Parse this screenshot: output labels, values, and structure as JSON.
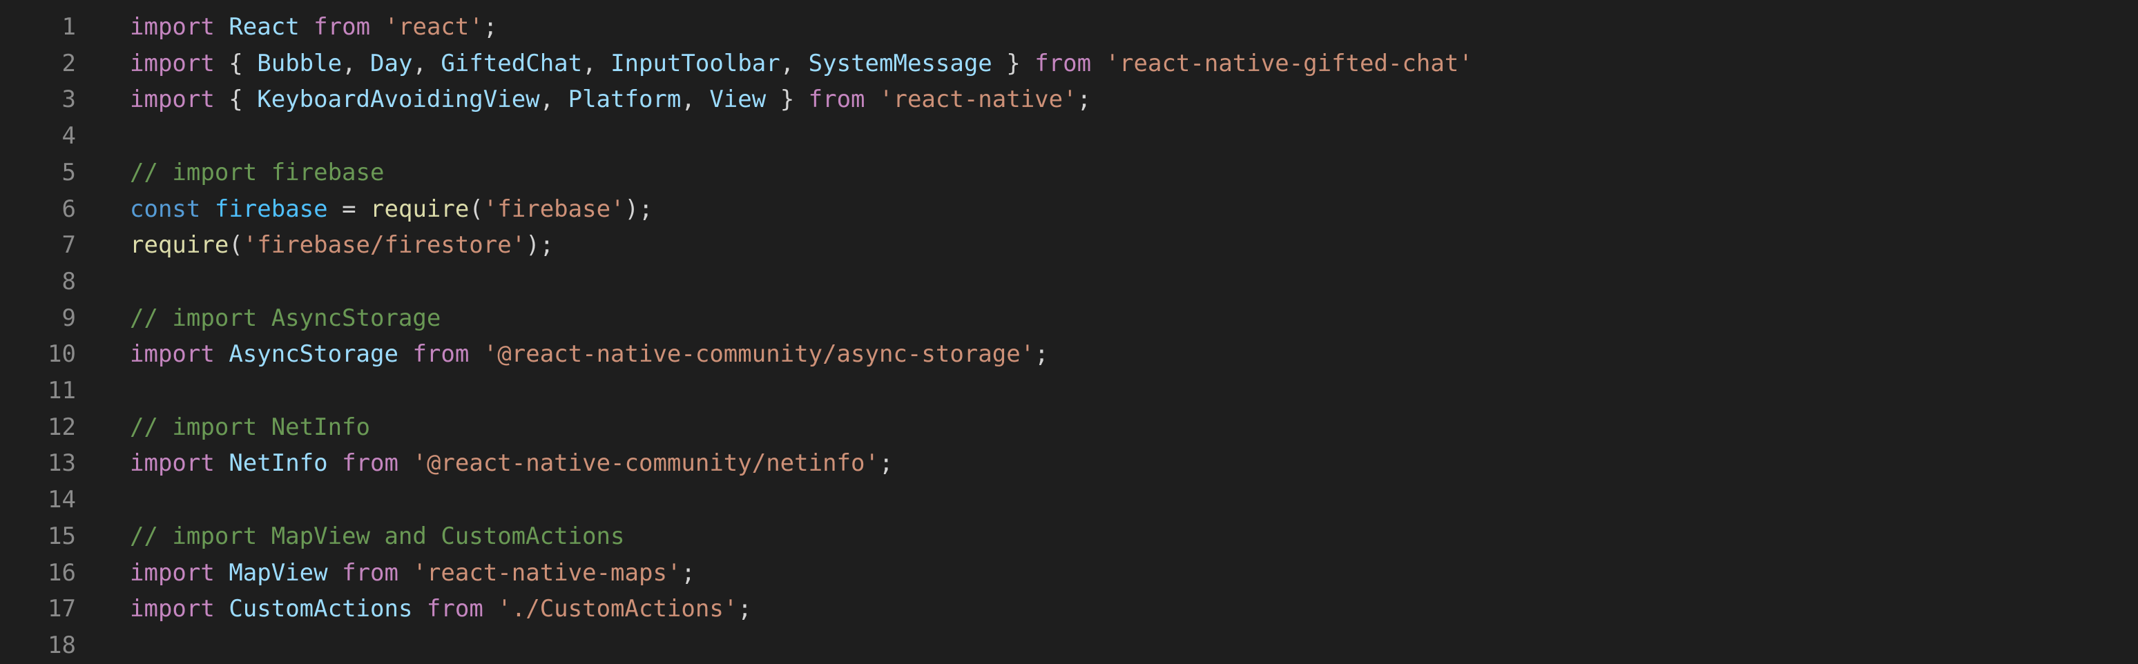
{
  "editor": {
    "lines": [
      {
        "num": "1",
        "tokens": [
          {
            "t": "kw",
            "v": "import"
          },
          {
            "t": "pun",
            "v": " "
          },
          {
            "t": "var",
            "v": "React"
          },
          {
            "t": "pun",
            "v": " "
          },
          {
            "t": "kw",
            "v": "from"
          },
          {
            "t": "pun",
            "v": " "
          },
          {
            "t": "str",
            "v": "'react'"
          },
          {
            "t": "pun",
            "v": ";"
          }
        ]
      },
      {
        "num": "2",
        "tokens": [
          {
            "t": "kw",
            "v": "import"
          },
          {
            "t": "pun",
            "v": " { "
          },
          {
            "t": "var",
            "v": "Bubble"
          },
          {
            "t": "pun",
            "v": ", "
          },
          {
            "t": "var",
            "v": "Day"
          },
          {
            "t": "pun",
            "v": ", "
          },
          {
            "t": "var",
            "v": "GiftedChat"
          },
          {
            "t": "pun",
            "v": ", "
          },
          {
            "t": "var",
            "v": "InputToolbar"
          },
          {
            "t": "pun",
            "v": ", "
          },
          {
            "t": "var",
            "v": "SystemMessage"
          },
          {
            "t": "pun",
            "v": " } "
          },
          {
            "t": "kw",
            "v": "from"
          },
          {
            "t": "pun",
            "v": " "
          },
          {
            "t": "str",
            "v": "'react-native-gifted-chat'"
          }
        ]
      },
      {
        "num": "3",
        "tokens": [
          {
            "t": "kw",
            "v": "import"
          },
          {
            "t": "pun",
            "v": " { "
          },
          {
            "t": "var",
            "v": "KeyboardAvoidingView"
          },
          {
            "t": "pun",
            "v": ", "
          },
          {
            "t": "var",
            "v": "Platform"
          },
          {
            "t": "pun",
            "v": ", "
          },
          {
            "t": "var",
            "v": "View"
          },
          {
            "t": "pun",
            "v": " } "
          },
          {
            "t": "kw",
            "v": "from"
          },
          {
            "t": "pun",
            "v": " "
          },
          {
            "t": "str",
            "v": "'react-native'"
          },
          {
            "t": "pun",
            "v": ";"
          }
        ]
      },
      {
        "num": "4",
        "tokens": []
      },
      {
        "num": "5",
        "tokens": [
          {
            "t": "cmt",
            "v": "// import firebase"
          }
        ]
      },
      {
        "num": "6",
        "tokens": [
          {
            "t": "cst",
            "v": "const"
          },
          {
            "t": "pun",
            "v": " "
          },
          {
            "t": "cv",
            "v": "firebase"
          },
          {
            "t": "pun",
            "v": " = "
          },
          {
            "t": "fn",
            "v": "require"
          },
          {
            "t": "pun",
            "v": "("
          },
          {
            "t": "str",
            "v": "'firebase'"
          },
          {
            "t": "pun",
            "v": ");"
          }
        ]
      },
      {
        "num": "7",
        "tokens": [
          {
            "t": "fn",
            "v": "require"
          },
          {
            "t": "pun",
            "v": "("
          },
          {
            "t": "str",
            "v": "'firebase/firestore'"
          },
          {
            "t": "pun",
            "v": ");"
          }
        ]
      },
      {
        "num": "8",
        "tokens": []
      },
      {
        "num": "9",
        "tokens": [
          {
            "t": "cmt",
            "v": "// import AsyncStorage"
          }
        ]
      },
      {
        "num": "10",
        "tokens": [
          {
            "t": "kw",
            "v": "import"
          },
          {
            "t": "pun",
            "v": " "
          },
          {
            "t": "var",
            "v": "AsyncStorage"
          },
          {
            "t": "pun",
            "v": " "
          },
          {
            "t": "kw",
            "v": "from"
          },
          {
            "t": "pun",
            "v": " "
          },
          {
            "t": "str",
            "v": "'@react-native-community/async-storage'"
          },
          {
            "t": "pun",
            "v": ";"
          }
        ]
      },
      {
        "num": "11",
        "tokens": []
      },
      {
        "num": "12",
        "tokens": [
          {
            "t": "cmt",
            "v": "// import NetInfo"
          }
        ]
      },
      {
        "num": "13",
        "tokens": [
          {
            "t": "kw",
            "v": "import"
          },
          {
            "t": "pun",
            "v": " "
          },
          {
            "t": "var",
            "v": "NetInfo"
          },
          {
            "t": "pun",
            "v": " "
          },
          {
            "t": "kw",
            "v": "from"
          },
          {
            "t": "pun",
            "v": " "
          },
          {
            "t": "str",
            "v": "'@react-native-community/netinfo'"
          },
          {
            "t": "pun",
            "v": ";"
          }
        ]
      },
      {
        "num": "14",
        "tokens": []
      },
      {
        "num": "15",
        "tokens": [
          {
            "t": "cmt",
            "v": "// import MapView and CustomActions"
          }
        ]
      },
      {
        "num": "16",
        "tokens": [
          {
            "t": "kw",
            "v": "import"
          },
          {
            "t": "pun",
            "v": " "
          },
          {
            "t": "var",
            "v": "MapView"
          },
          {
            "t": "pun",
            "v": " "
          },
          {
            "t": "kw",
            "v": "from"
          },
          {
            "t": "pun",
            "v": " "
          },
          {
            "t": "str",
            "v": "'react-native-maps'"
          },
          {
            "t": "pun",
            "v": ";"
          }
        ]
      },
      {
        "num": "17",
        "tokens": [
          {
            "t": "kw",
            "v": "import"
          },
          {
            "t": "pun",
            "v": " "
          },
          {
            "t": "var",
            "v": "CustomActions"
          },
          {
            "t": "pun",
            "v": " "
          },
          {
            "t": "kw",
            "v": "from"
          },
          {
            "t": "pun",
            "v": " "
          },
          {
            "t": "str",
            "v": "'./CustomActions'"
          },
          {
            "t": "pun",
            "v": ";"
          }
        ]
      },
      {
        "num": "18",
        "tokens": []
      }
    ]
  },
  "colors": {
    "background": "#1e1e1e",
    "line_number": "#8b8b8b",
    "keyword": "#c586c0",
    "storage": "#569cd6",
    "identifier": "#9cdcfe",
    "constant": "#4fc1ff",
    "function": "#dcdcaa",
    "string": "#ce9178",
    "comment": "#6a9955",
    "punctuation": "#d4d4d4"
  }
}
